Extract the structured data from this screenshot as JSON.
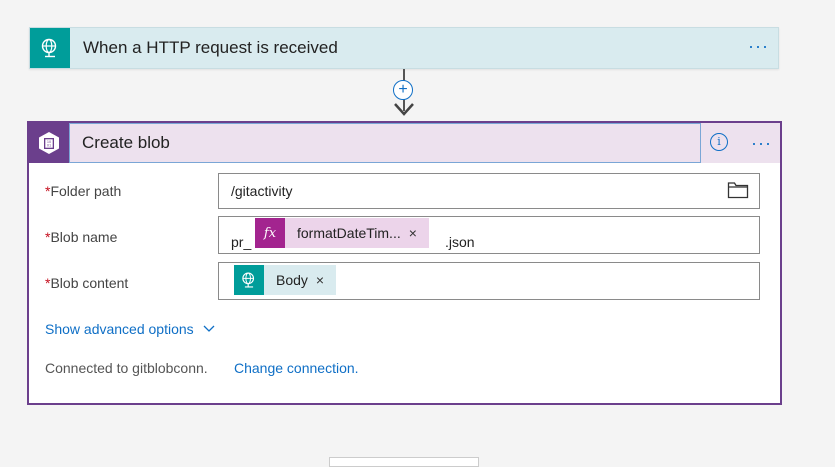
{
  "trigger": {
    "title": "When a HTTP request is received",
    "more": "···",
    "icon": "globe-icon",
    "color": "#009d9a"
  },
  "connector": {
    "add": "+"
  },
  "action": {
    "title": "Create blob",
    "info": "i",
    "more": "···",
    "icon": "blob-icon",
    "color": "#6b3f8c",
    "fields": {
      "folder_path": {
        "required": "*",
        "label": "Folder path",
        "value": "/gitactivity",
        "icon": "folder-icon"
      },
      "blob_name": {
        "required": "*",
        "label": "Blob name",
        "prefix": "pr_",
        "token": {
          "icon": "fx-icon",
          "icon_text": "fx",
          "label": "formatDateTim...",
          "remove": "×",
          "color": "#ecd4ea"
        },
        "suffix": ".json"
      },
      "blob_content": {
        "required": "*",
        "label": "Blob content",
        "token": {
          "icon": "globe-icon",
          "label": "Body",
          "remove": "×",
          "color": "#d9ebef"
        }
      }
    },
    "advanced": "Show advanced options",
    "connection_text": "Connected to gitblobconn.",
    "connection_link": "Change connection."
  }
}
